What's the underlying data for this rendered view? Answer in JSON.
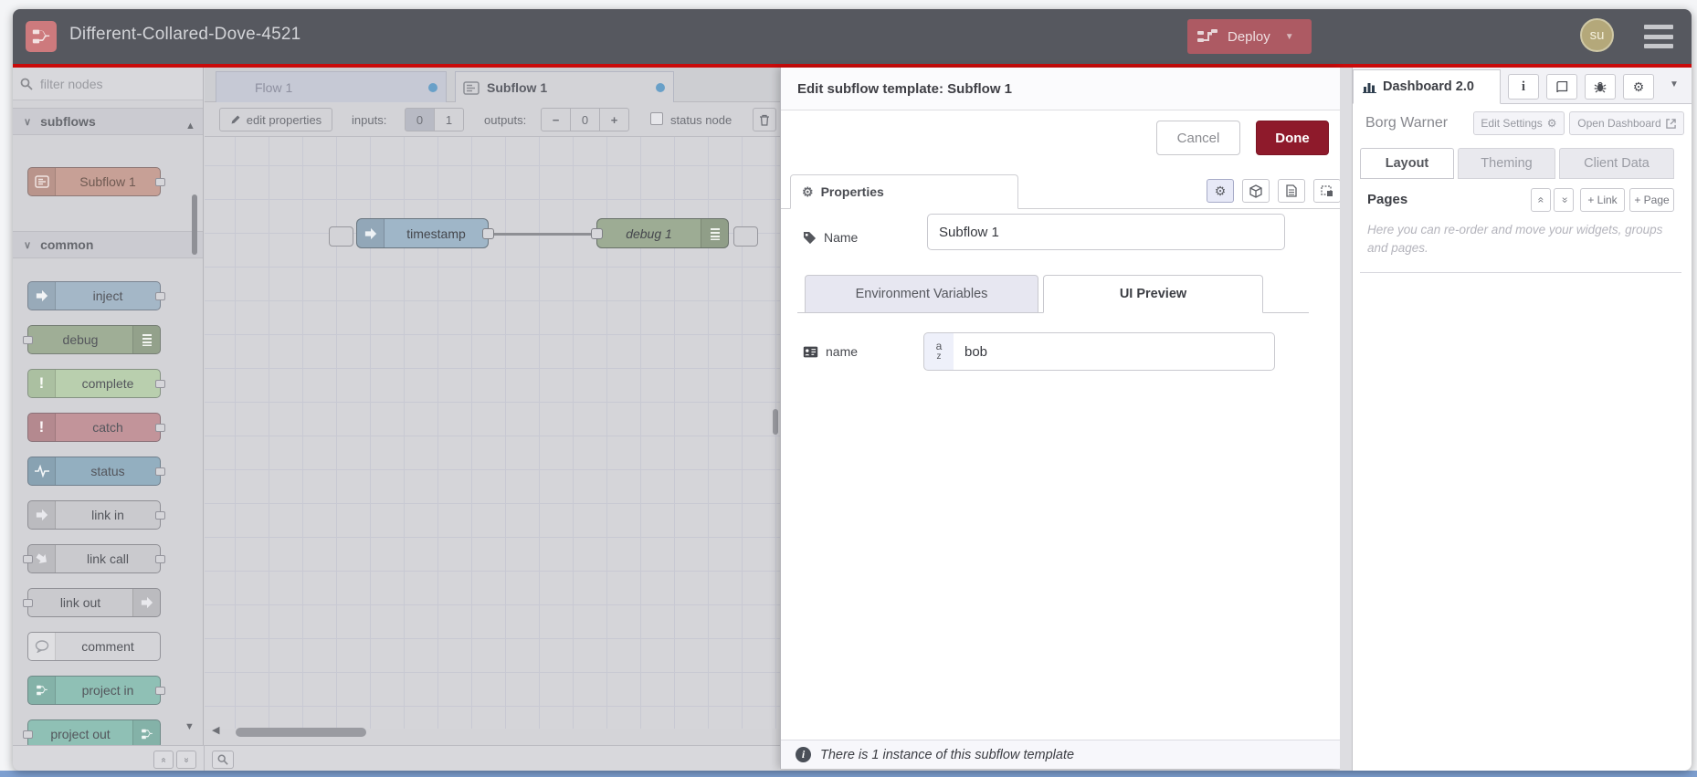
{
  "window": {
    "title": "Different-Collared-Dove-4521"
  },
  "header": {
    "deploy_label": "Deploy",
    "avatar_text": "su"
  },
  "palette": {
    "search_placeholder": "filter nodes",
    "category_subflows": "subflows",
    "category_common": "common",
    "subflow_item": {
      "label": "Subflow 1",
      "color": "#c7a096"
    },
    "common_items": [
      {
        "label": "inject",
        "color": "#a4b7c7"
      },
      {
        "label": "debug",
        "color": "#9fae96"
      },
      {
        "label": "complete",
        "color": "#b9cfae"
      },
      {
        "label": "catch",
        "color": "#c2949a"
      },
      {
        "label": "status",
        "color": "#93afc0"
      },
      {
        "label": "link in",
        "color": "#cacace"
      },
      {
        "label": "link call",
        "color": "#cacace"
      },
      {
        "label": "link out",
        "color": "#cacace"
      },
      {
        "label": "comment",
        "color": "#d4d4d8"
      },
      {
        "label": "project in",
        "color": "#8fc0b5"
      },
      {
        "label": "project out",
        "color": "#8fc0b5"
      }
    ]
  },
  "workspace": {
    "tabs": [
      {
        "label": "Flow 1"
      },
      {
        "label": "Subflow 1"
      }
    ],
    "toolbar": {
      "edit_properties": "edit properties",
      "inputs_label": "inputs:",
      "input_options": [
        "0",
        "1"
      ],
      "outputs_label": "outputs:",
      "minus": "−",
      "output_value": "0",
      "plus": "+",
      "status_node_label": "status node"
    },
    "nodes": [
      {
        "label": "timestamp",
        "color": "#9fb6c8"
      },
      {
        "label": "debug 1",
        "color": "#9dac94"
      }
    ]
  },
  "dialog": {
    "title": "Edit subflow template: Subflow 1",
    "cancel_label": "Cancel",
    "done_label": "Done",
    "properties_tab": "Properties",
    "name_label": "Name",
    "name_value": "Subflow 1",
    "env_tab": "Environment Variables",
    "ui_tab": "UI Preview",
    "field_label": "name",
    "field_value": "bob",
    "footer_text": "There is 1 instance of this subflow template"
  },
  "sidebar": {
    "tab_label": "Dashboard 2.0",
    "project_name": "Borg Warner",
    "edit_settings_label": "Edit Settings",
    "open_dashboard_label": "Open Dashboard",
    "tabs": [
      {
        "label": "Layout"
      },
      {
        "label": "Theming"
      },
      {
        "label": "Client Data"
      }
    ],
    "pages_title": "Pages",
    "link_button": "+ Link",
    "page_button": "+ Page",
    "help_text": "Here you can re-order and move your widgets, groups and pages."
  },
  "icons": {
    "gear": "⚙",
    "caret_down": "▼",
    "chevron_down": "∨",
    "collapse": "«",
    "up_triangle": "▲",
    "down_triangle": "▼",
    "left_triangle": "◀"
  },
  "colors": {
    "accent_red_line": "#c90a0a",
    "deploy_bg": "#ad5a63",
    "done_bg": "#8e1a2b",
    "tab_dot_blue": "#69a0c8",
    "header_bg": "#56585f",
    "wire": "#8e8f94"
  }
}
